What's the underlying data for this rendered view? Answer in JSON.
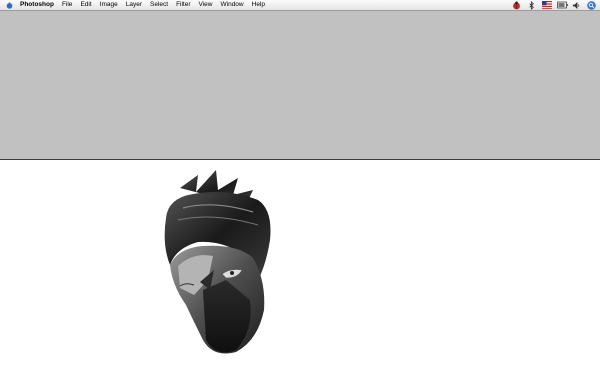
{
  "menubar": {
    "app_name": "Photoshop",
    "menus": [
      "File",
      "Edit",
      "Image",
      "Layer",
      "Select",
      "Filter",
      "View",
      "Window",
      "Help"
    ],
    "status_icons": [
      "ladybug-icon",
      "bluetooth-icon",
      "us-flag-icon",
      "battery-icon",
      "volume-icon",
      "spotlight-search-icon"
    ]
  },
  "colors": {
    "workspace_gray": "#c1c1c1",
    "canvas_white": "#ffffff",
    "spotlight_blue": "#3b78d8"
  }
}
